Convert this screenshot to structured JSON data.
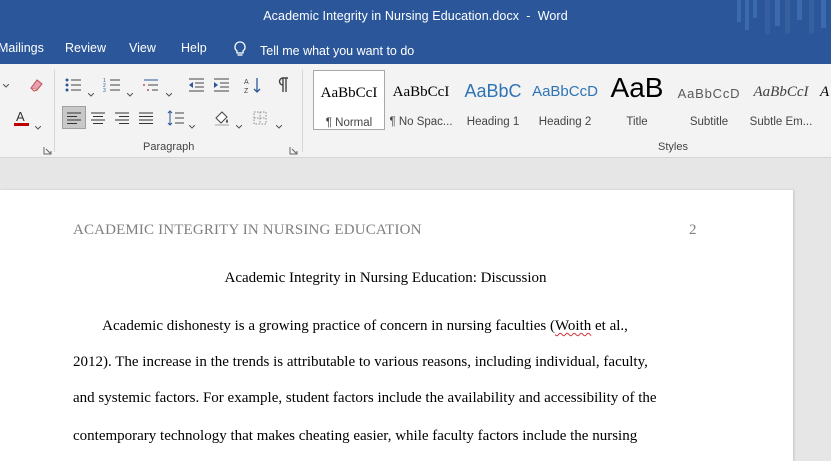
{
  "window": {
    "title": "Academic Integrity in Nursing Education.docx  -  Word"
  },
  "menu": {
    "items": [
      "Mailings",
      "Review",
      "View",
      "Help"
    ],
    "tell_me": "Tell me what you want to do"
  },
  "ribbon": {
    "groups": {
      "paragraph": "Paragraph",
      "styles": "Styles"
    },
    "styles": [
      {
        "sample": "AaBbCcI",
        "name": "¶ Normal",
        "selected": true,
        "color": "#000000"
      },
      {
        "sample": "AaBbCcI",
        "name": "¶ No Spac...",
        "selected": false,
        "color": "#000000"
      },
      {
        "sample": "AaBbC",
        "name": "Heading 1",
        "selected": false,
        "color": "#2e74b5"
      },
      {
        "sample": "AaBbCcD",
        "name": "Heading 2",
        "selected": false,
        "color": "#2e74b5"
      },
      {
        "sample": "AaB",
        "name": "Title",
        "selected": false,
        "color": "#000000"
      },
      {
        "sample": "AaBbCcD",
        "name": "Subtitle",
        "selected": false,
        "color": "#595959"
      },
      {
        "sample": "AaBbCcI",
        "name": "Subtle Em...",
        "selected": false,
        "color": "#404040"
      },
      {
        "sample": "A",
        "name": "",
        "selected": false,
        "color": "#000000"
      }
    ]
  },
  "document": {
    "header_left": "ACADEMIC INTEGRITY IN NURSING EDUCATION",
    "page_number": "2",
    "title": "Academic Integrity in Nursing Education: Discussion",
    "lines": [
      {
        "before": "        Academic dishonesty is a growing practice of concern in nursing faculties (",
        "flagged": "Woith",
        "after": " et al.,"
      },
      {
        "before": "2012). The increase in the trends is attributable to various reasons, including individual, faculty,",
        "flagged": "",
        "after": ""
      },
      {
        "before": "and systemic factors. For example, student factors include the availability and accessibility of the",
        "flagged": "",
        "after": ""
      },
      {
        "before": "contemporary technology that makes cheating easier, while faculty factors include the nursing",
        "flagged": "",
        "after": ""
      }
    ]
  },
  "colors": {
    "brand": "#2b579a",
    "font_red": "#c00000",
    "heading_blue": "#2e74b5"
  }
}
